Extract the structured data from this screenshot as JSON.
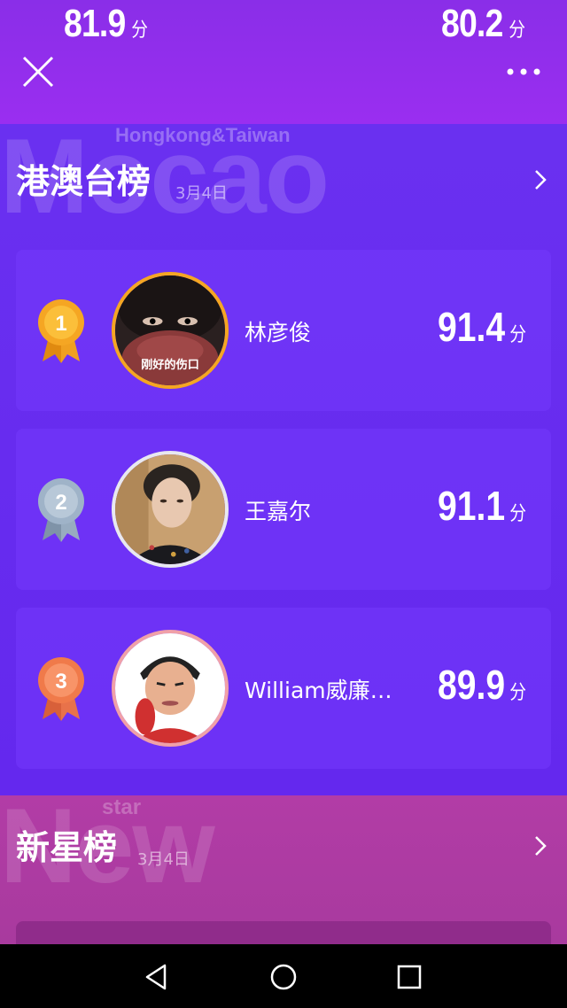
{
  "top": {
    "score_left": "81.9",
    "score_right": "80.2",
    "unit": "分"
  },
  "hk_section": {
    "bg_word": "Mocao",
    "bg_sub": "Hongkong&Taiwan",
    "title": "港澳台榜",
    "date": "3月4日",
    "entries": [
      {
        "rank": "1",
        "name": "林彦俊",
        "score": "91.4",
        "unit": "分",
        "cover_text": "刚好的伤口",
        "medal_color": "#f5a623"
      },
      {
        "rank": "2",
        "name": "王嘉尔",
        "score": "91.1",
        "unit": "分",
        "medal_color": "#9fb3c8"
      },
      {
        "rank": "3",
        "name": "William威廉…",
        "score": "89.9",
        "unit": "分",
        "medal_color": "#f07a4a"
      }
    ]
  },
  "new_section": {
    "bg_word": "New",
    "bg_sub": "star",
    "title": "新星榜",
    "date": "3月4日"
  },
  "colors": {
    "top_bar": "#9a2ef0",
    "hk_bg": "#6a30f0",
    "new_bg": "#b23ca6",
    "gold": "#f5a623",
    "silver": "#9fb3c8",
    "bronze": "#f07a4a"
  }
}
